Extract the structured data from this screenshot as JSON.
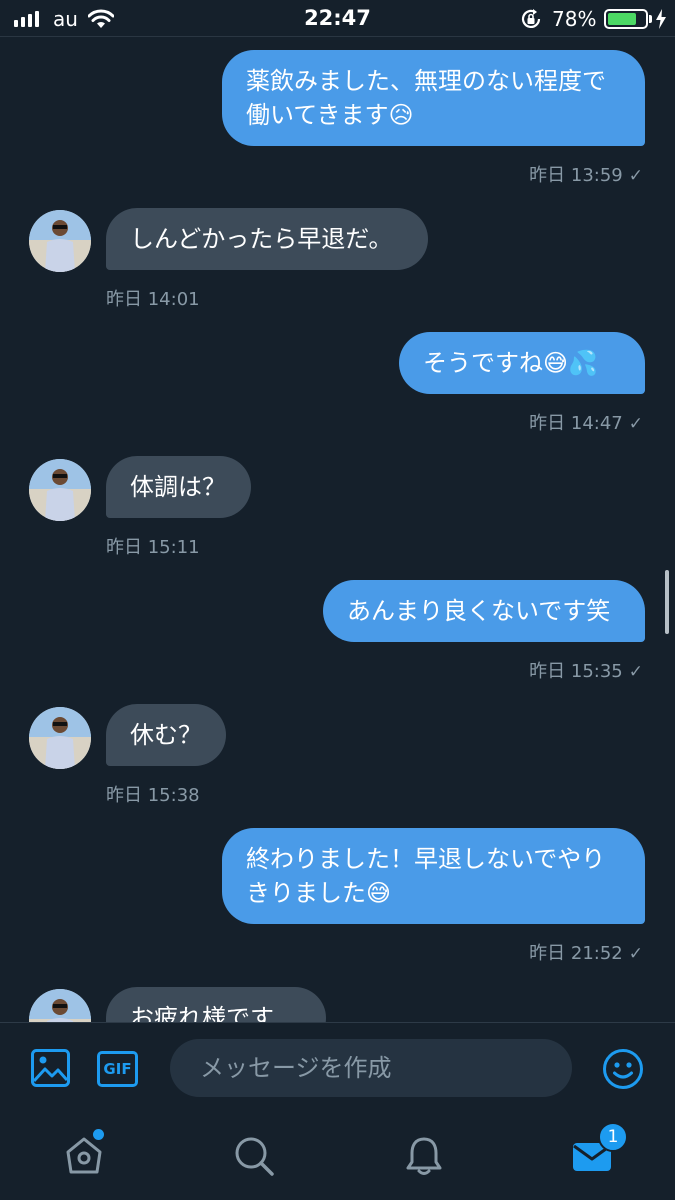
{
  "status_bar": {
    "carrier": "au",
    "time": "22:47",
    "battery_percent": "78%",
    "battery_level": 0.78,
    "battery_color": "#4cd964"
  },
  "messages": [
    {
      "side": "sent",
      "lines": [
        "薬飲みました、無理のない程度で",
        "働いてきます😥"
      ],
      "time": "昨日 13:59",
      "check": "✓"
    },
    {
      "side": "received",
      "lines": [
        "しんどかったら早退だ。"
      ],
      "time": "昨日 14:01"
    },
    {
      "side": "sent",
      "lines": [
        "そうですね😅💦"
      ],
      "time": "昨日 14:47",
      "check": "✓"
    },
    {
      "side": "received",
      "lines": [
        "体調は？"
      ],
      "time": "昨日 15:11"
    },
    {
      "side": "sent",
      "lines": [
        "あんまり良くないです笑"
      ],
      "time": "昨日 15:35",
      "check": "✓"
    },
    {
      "side": "received",
      "lines": [
        "休む？"
      ],
      "time": "昨日 15:38"
    },
    {
      "side": "sent",
      "lines": [
        "終わりました！早退しないでやり",
        "きりました😅"
      ],
      "time": "昨日 21:52",
      "check": "✓"
    },
    {
      "side": "received",
      "lines": [
        "お疲れ様です"
      ]
    }
  ],
  "composer": {
    "placeholder": "メッセージを作成",
    "gif_label": "GIF"
  },
  "tabbar": {
    "messages_badge": "1"
  },
  "colors": {
    "background": "#15202b",
    "sent_bubble": "#4a9be8",
    "received_bubble": "#3d4b59",
    "accent": "#1d9bf0",
    "muted_text": "#8899a6"
  },
  "icons": [
    "image-icon",
    "gif-icon",
    "emoji-icon",
    "home-icon",
    "search-icon",
    "notifications-icon",
    "messages-icon"
  ]
}
